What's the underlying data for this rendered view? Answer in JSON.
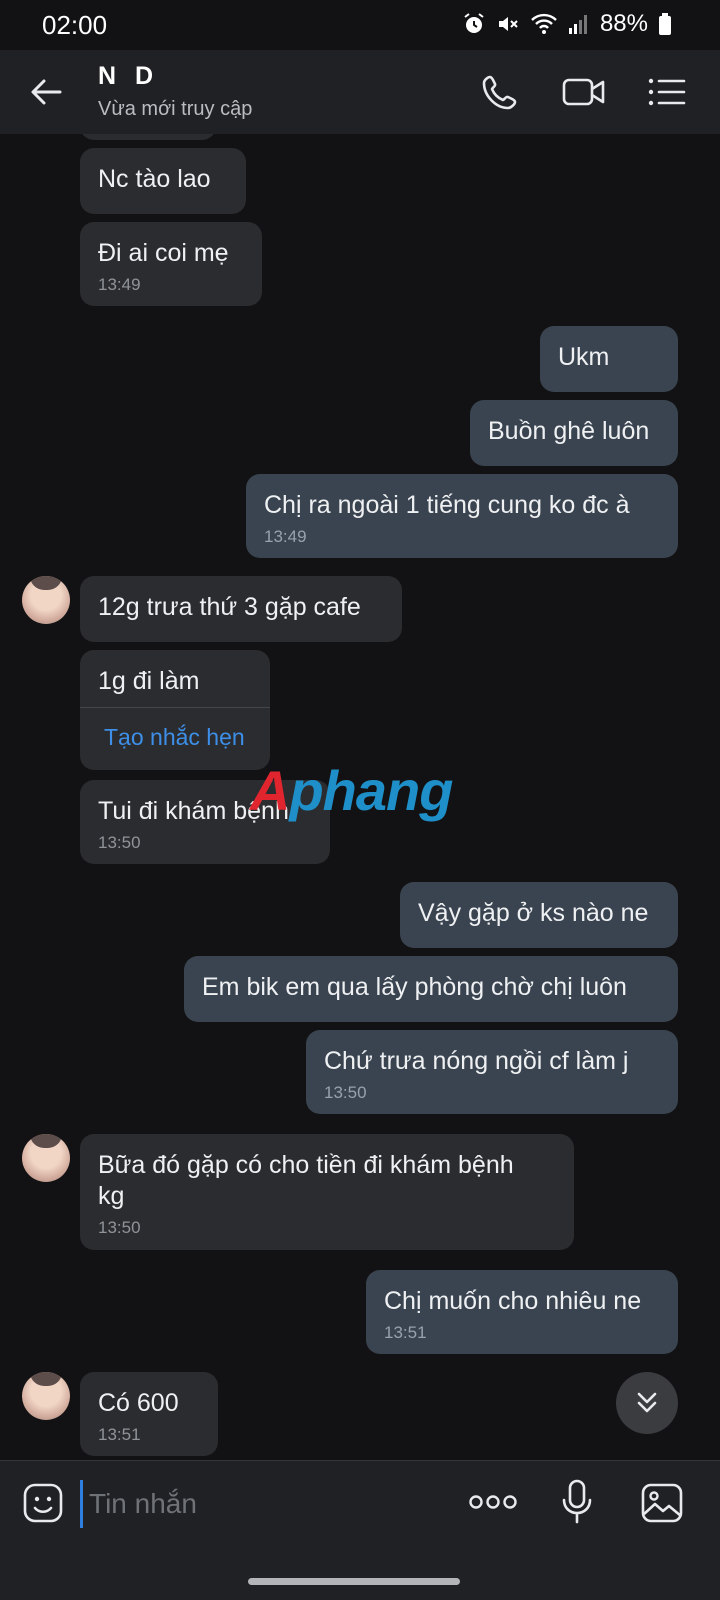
{
  "status_bar": {
    "time": "02:00",
    "battery": "88%"
  },
  "header": {
    "contact_name": "N D",
    "contact_status": "Vừa mới truy cập"
  },
  "messages": {
    "m1": "Nc tào lao",
    "m2": {
      "text": "Đi ai coi mẹ",
      "time": "13:49"
    },
    "m3": "Ukm",
    "m4": "Buồn ghê luôn",
    "m5": {
      "text": "Chị ra ngoài 1 tiếng cung ko đc à",
      "time": "13:49"
    },
    "m6": "12g trưa thứ 3 gặp cafe",
    "m7": {
      "text": "1g đi làm",
      "action": "Tạo nhắc hẹn"
    },
    "m8": {
      "text": "Tui đi khám bệnh",
      "time": "13:50"
    },
    "m9": "Vậy gặp ở ks nào ne",
    "m10": "Em bik em qua lấy phòng chờ chị luôn",
    "m11": {
      "text": "Chứ trưa nóng ngồi cf làm j",
      "time": "13:50"
    },
    "m12": {
      "line1": "Bữa đó gặp có cho tiền đi khám bệnh",
      "line2": "kg",
      "time": "13:50"
    },
    "m13": {
      "text": "Chị muốn cho nhiêu ne",
      "time": "13:51"
    },
    "m14": {
      "text": "Có 600",
      "time": "13:51"
    }
  },
  "watermark": {
    "part1": "A",
    "part2": "phang"
  },
  "composer": {
    "placeholder": "Tin nhắn"
  },
  "colors": {
    "incoming_bubble": "#2b2c2f",
    "outgoing_bubble": "#3a4450",
    "link": "#3d8fe8"
  }
}
